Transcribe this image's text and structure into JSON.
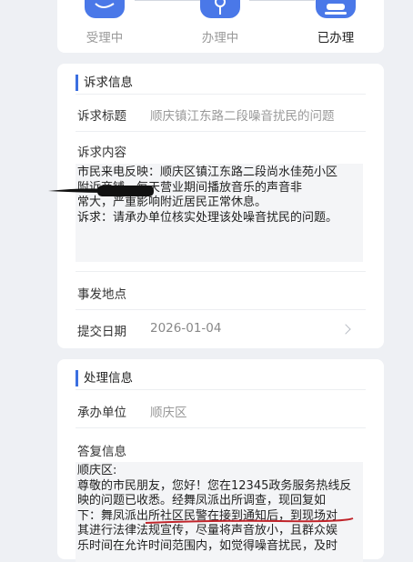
{
  "progress": {
    "steps": [
      {
        "label": "受理中",
        "state": "done"
      },
      {
        "label": "办理中",
        "state": "done"
      },
      {
        "label": "已办理",
        "state": "current"
      }
    ]
  },
  "complaint": {
    "section_title": "诉求信息",
    "title_label": "诉求标题",
    "title_value": "顺庆镇江东路二段噪音扰民的问题",
    "content_label": "诉求内容",
    "content_text": "市民来电反映：顺庆区镇江东路二段尚水佳苑小区\n附近商铺，每天营业期间播放音乐的声音非\n常大，严重影响附近居民正常休息。\n诉求：请承办单位核实处理该处噪音扰民的问题。",
    "location_label": "事发地点",
    "location_value": "",
    "date_label": "提交日期",
    "date_value": "2026-01-04"
  },
  "handling": {
    "section_title": "处理信息",
    "unit_label": "承办单位",
    "unit_value": "顺庆区",
    "reply_label": "答复信息",
    "reply_text": "顺庆区:\n尊敬的市民朋友，您好！您在12345政务服务热线反\n映的问题已收悉。经舞凤派出所调查，现回复如\n下：舞凤派出所社区民警在接到通知后，到现场对\n其进行法律法规宣传，尽量将声音放小，且群众娱\n乐时间在允许时间范围内，如觉得噪音扰民，及时"
  },
  "colors": {
    "accent": "#3b6fe0",
    "step_icon": "#4a78e8",
    "annotation_red": "#c0242a"
  }
}
